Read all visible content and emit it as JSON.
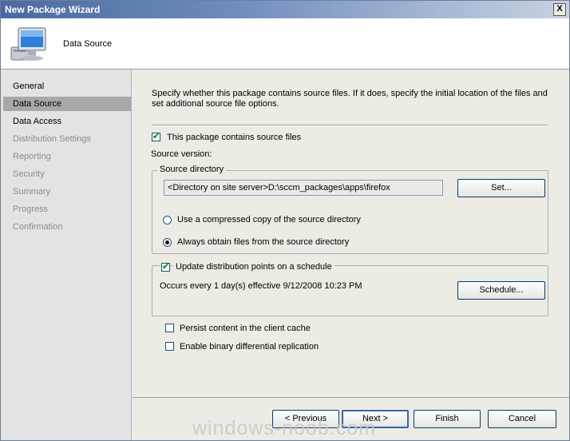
{
  "window": {
    "title": "New Package Wizard",
    "close_label": "X"
  },
  "header": {
    "title": "Data Source",
    "icon": "computer-icon"
  },
  "sidebar": {
    "items": [
      {
        "label": "General",
        "state": "normal"
      },
      {
        "label": "Data Source",
        "state": "selected"
      },
      {
        "label": "Data Access",
        "state": "normal"
      },
      {
        "label": "Distribution Settings",
        "state": "disabled"
      },
      {
        "label": "Reporting",
        "state": "disabled"
      },
      {
        "label": "Security",
        "state": "disabled"
      },
      {
        "label": "Summary",
        "state": "disabled"
      },
      {
        "label": "Progress",
        "state": "disabled"
      },
      {
        "label": "Confirmation",
        "state": "disabled"
      }
    ]
  },
  "main": {
    "description": "Specify whether this package contains source files. If it does, specify the initial location of the files and set additional source file options.",
    "contains_source": {
      "label": "This package contains source files",
      "checked": true
    },
    "source_version_label": "Source version:",
    "source_directory": {
      "legend": "Source directory",
      "path": "<Directory on site server>D:\\sccm_packages\\apps\\firefox",
      "set_button": "Set...",
      "options": [
        {
          "label": "Use a compressed copy of the source directory",
          "selected": false
        },
        {
          "label": "Always obtain files from the source directory",
          "selected": true
        }
      ]
    },
    "update_schedule": {
      "label": "Update distribution points on a schedule",
      "checked": true,
      "description": "Occurs every 1 day(s) effective 9/12/2008 10:23 PM",
      "schedule_button": "Schedule..."
    },
    "persist_cache": {
      "label": "Persist content in the client cache",
      "checked": false
    },
    "binary_diff": {
      "label": "Enable binary differential replication",
      "checked": false
    }
  },
  "footer": {
    "previous": "< Previous",
    "next": "Next >",
    "finish": "Finish",
    "cancel": "Cancel"
  },
  "watermark": "windows-noob.com",
  "colors": {
    "title_gradient_start": "#4a6aa0",
    "selected_nav": "#a8a8a8",
    "check_mark": "#21a121"
  }
}
